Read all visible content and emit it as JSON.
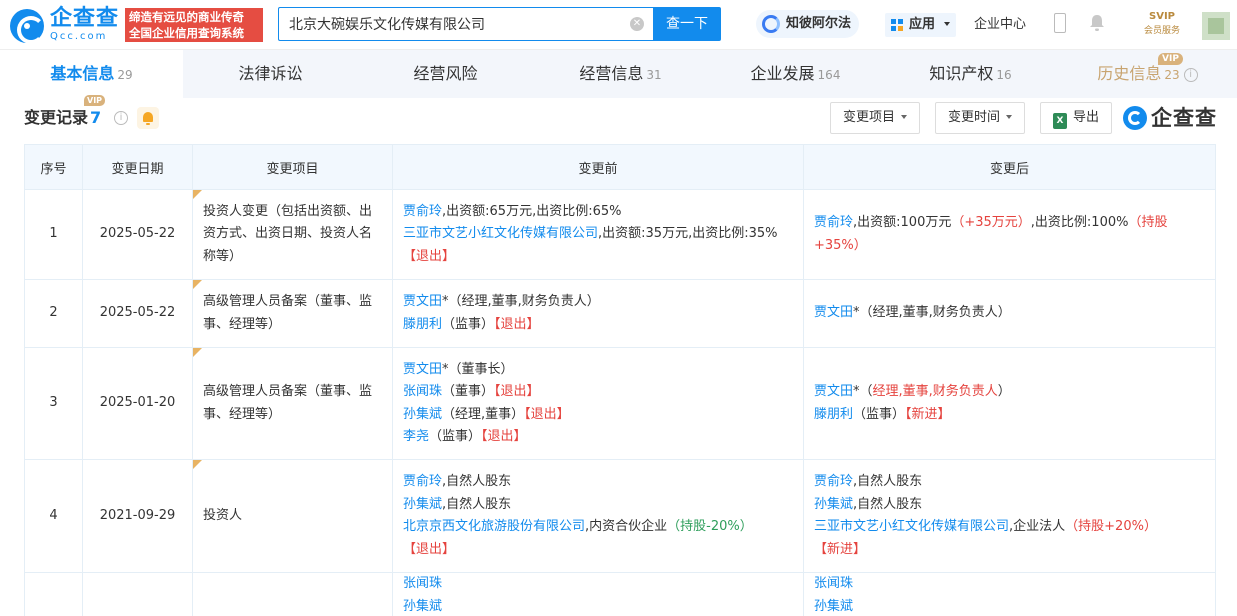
{
  "header": {
    "logo_text": "企查查",
    "logo_sub": "Qcc.com",
    "slogan_line1": "缔造有远见的商业传奇",
    "slogan_line2": "全国企业信用查询系统",
    "search_value": "北京大碗娱乐文化传媒有限公司",
    "search_button": "查一下",
    "zhibi_label": "知彼阿尔法",
    "apps_label": "应用",
    "enterprise_center": "企业中心",
    "svip_top": "SVIP",
    "svip_bottom": "会员服务",
    "icons": [
      "search-clear-icon",
      "phone-icon",
      "bell-icon",
      "avatar"
    ]
  },
  "tabs": [
    {
      "label": "基本信息",
      "count": "29",
      "active": true
    },
    {
      "label": "法律诉讼",
      "count": ""
    },
    {
      "label": "经营风险",
      "count": ""
    },
    {
      "label": "经营信息",
      "count": "31"
    },
    {
      "label": "企业发展",
      "count": "164"
    },
    {
      "label": "知识产权",
      "count": "16"
    },
    {
      "label": "历史信息",
      "count": "23",
      "vip": "VIP"
    }
  ],
  "section": {
    "title": "变更记录",
    "count": "7",
    "vip": "VIP",
    "filter_item": "变更项目",
    "filter_time": "变更时间",
    "export": "导出",
    "brand": "企查查"
  },
  "table": {
    "headers": [
      "序号",
      "变更日期",
      "变更项目",
      "变更前",
      "变更后"
    ],
    "rows": [
      {
        "no": "1",
        "date": "2025-05-22",
        "item": "投资人变更（包括出资额、出资方式、出资日期、投资人名称等）",
        "before": [
          {
            "parts": [
              {
                "t": "贾俞玲",
                "c": "lnk"
              },
              {
                "t": ",出资额:65万元,出资比例:65%"
              }
            ]
          },
          {
            "parts": [
              {
                "t": "三亚市文艺小红文化传媒有限公司",
                "c": "lnk"
              },
              {
                "t": ",出资额:35万元,出资比例:35%"
              },
              {
                "t": "【退出】",
                "c": "tag-red"
              }
            ]
          }
        ],
        "after": [
          {
            "parts": [
              {
                "t": "贾俞玲",
                "c": "lnk"
              },
              {
                "t": ",出资额:100万元"
              },
              {
                "t": "（+35万元）",
                "c": "tag-up"
              },
              {
                "t": ",出资比例:100%"
              },
              {
                "t": "（持股+35%）",
                "c": "tag-up"
              }
            ]
          }
        ]
      },
      {
        "no": "2",
        "date": "2025-05-22",
        "item": "高级管理人员备案（董事、监事、经理等）",
        "before": [
          {
            "parts": [
              {
                "t": "贾文田",
                "c": "lnk"
              },
              {
                "t": "*（经理,董事,财务负责人）"
              }
            ]
          },
          {
            "parts": [
              {
                "t": "滕朋利",
                "c": "lnk"
              },
              {
                "t": "（监事）"
              },
              {
                "t": "【退出】",
                "c": "tag-red"
              }
            ]
          }
        ],
        "after": [
          {
            "parts": [
              {
                "t": "贾文田",
                "c": "lnk"
              },
              {
                "t": "*（经理,董事,财务负责人）"
              }
            ]
          }
        ]
      },
      {
        "no": "3",
        "date": "2025-01-20",
        "item": "高级管理人员备案（董事、监事、经理等）",
        "before": [
          {
            "parts": [
              {
                "t": "贾文田",
                "c": "lnk"
              },
              {
                "t": "*（董事长）"
              }
            ]
          },
          {
            "parts": [
              {
                "t": "张闻珠",
                "c": "lnk"
              },
              {
                "t": "（董事）"
              },
              {
                "t": "【退出】",
                "c": "tag-red"
              }
            ]
          },
          {
            "parts": [
              {
                "t": "孙集斌",
                "c": "lnk"
              },
              {
                "t": "（经理,董事）"
              },
              {
                "t": "【退出】",
                "c": "tag-red"
              }
            ]
          },
          {
            "parts": [
              {
                "t": "李尧",
                "c": "lnk"
              },
              {
                "t": "（监事）"
              },
              {
                "t": "【退出】",
                "c": "tag-red"
              }
            ]
          }
        ],
        "after": [
          {
            "parts": [
              {
                "t": "贾文田",
                "c": "lnk"
              },
              {
                "t": "*（"
              },
              {
                "t": "经理,董事,财务负责人",
                "c": "tag-red"
              },
              {
                "t": "）"
              }
            ]
          },
          {
            "parts": [
              {
                "t": "滕朋利",
                "c": "lnk"
              },
              {
                "t": "（监事）"
              },
              {
                "t": "【新进】",
                "c": "tag-red"
              }
            ]
          }
        ]
      },
      {
        "no": "4",
        "date": "2021-09-29",
        "item": "投资人",
        "before": [
          {
            "parts": [
              {
                "t": "贾俞玲",
                "c": "lnk"
              },
              {
                "t": ",自然人股东"
              }
            ]
          },
          {
            "parts": [
              {
                "t": "孙集斌",
                "c": "lnk"
              },
              {
                "t": ",自然人股东"
              }
            ]
          },
          {
            "parts": [
              {
                "t": "北京京西文化旅游股份有限公司",
                "c": "lnk"
              },
              {
                "t": ",内资合伙企业"
              },
              {
                "t": "（持股-20%）",
                "c": "tag-green"
              }
            ]
          },
          {
            "parts": [
              {
                "t": "【退出】",
                "c": "tag-red"
              }
            ]
          }
        ],
        "after": [
          {
            "parts": [
              {
                "t": "贾俞玲",
                "c": "lnk"
              },
              {
                "t": ",自然人股东"
              }
            ]
          },
          {
            "parts": [
              {
                "t": "孙集斌",
                "c": "lnk"
              },
              {
                "t": ",自然人股东"
              }
            ]
          },
          {
            "parts": [
              {
                "t": "三亚市文艺小红文化传媒有限公司",
                "c": "lnk"
              },
              {
                "t": ",企业法人"
              },
              {
                "t": "（持股+20%）",
                "c": "tag-up"
              }
            ]
          },
          {
            "parts": [
              {
                "t": "【新进】",
                "c": "tag-red"
              }
            ]
          }
        ]
      },
      {
        "no": "",
        "date": "",
        "item": "",
        "before": [
          {
            "parts": [
              {
                "t": "张闻珠",
                "c": "lnk"
              }
            ]
          },
          {
            "parts": [
              {
                "t": "孙集斌",
                "c": "lnk"
              }
            ]
          }
        ],
        "after": [
          {
            "parts": [
              {
                "t": "张闻珠",
                "c": "lnk"
              }
            ]
          },
          {
            "parts": [
              {
                "t": "孙集斌",
                "c": "lnk"
              }
            ]
          }
        ]
      }
    ]
  }
}
